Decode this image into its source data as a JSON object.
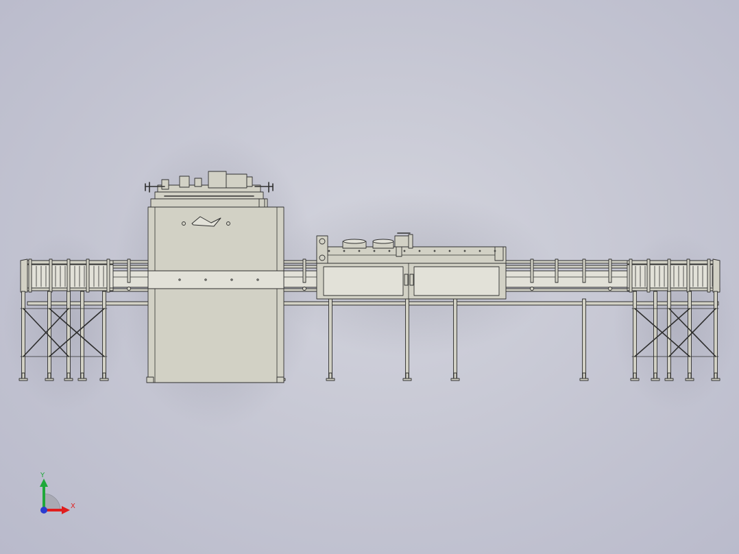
{
  "viewport": {
    "background_color": "#c9cad6",
    "model_fill": "#d2d1c5",
    "model_fill_light": "#e2e1d8",
    "model_stroke": "#2e2e2e"
  },
  "triad": {
    "x_label": "X",
    "y_label": "Y",
    "x_color": "#e01e1e",
    "y_color": "#1fa83a",
    "z_color": "#2a3bd0"
  }
}
